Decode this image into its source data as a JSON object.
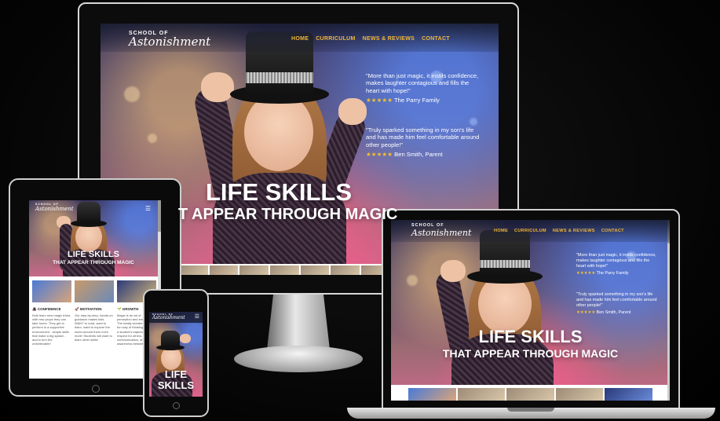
{
  "site": {
    "logo_top": "SCHOOL OF",
    "logo_main": "Astonishment",
    "nav": [
      "HOME",
      "CURRICULUM",
      "NEWS & REVIEWS",
      "CONTACT"
    ],
    "headline_1": "LIFE SKILLS",
    "headline_2_partial": "T APPEAR THROUGH MAGIC",
    "headline_2": "THAT APPEAR THROUGH MAGIC",
    "phone_headline_1": "LIFE",
    "phone_headline_2": "SKILLS",
    "menu_icon": "hamburger-icon",
    "accent": "#f2b637",
    "star_color": "#f2c12e"
  },
  "testimonials": [
    {
      "text": "\"More than just magic, it instils confidence, makes laughter contagious and fills the heart with hope!\"",
      "stars": "★★★★★",
      "author": "The Parry Family"
    },
    {
      "text": "\"Truly sparked something in my son's life and has made him feel comfortable around other people!\"",
      "stars": "★★★★★",
      "author": "Ben Smith, Parent"
    }
  ],
  "features": [
    {
      "icon": "top-hat-icon",
      "title": "CONFIDENCE",
      "body": "Kids learn new magic tricks with new props they can take home. They get to perform in a supportive environment - simple skills that make a big splash - and in turn the unbelievable!"
    },
    {
      "icon": "rocket-icon",
      "title": "MOTIVATION",
      "body": "Our step-by-step, hands-on guidance makes kids WANT to read, want to learn, want to explore the world around them even more! Students will want to learn other skills!"
    },
    {
      "icon": "sprout-icon",
      "title": "GROWTH",
      "body": "Magic is an art of perception and empathy. The totally wonderful and fun way of thinking changes a student's trajectory. We respect for others, communication, and social awareness between"
    }
  ]
}
